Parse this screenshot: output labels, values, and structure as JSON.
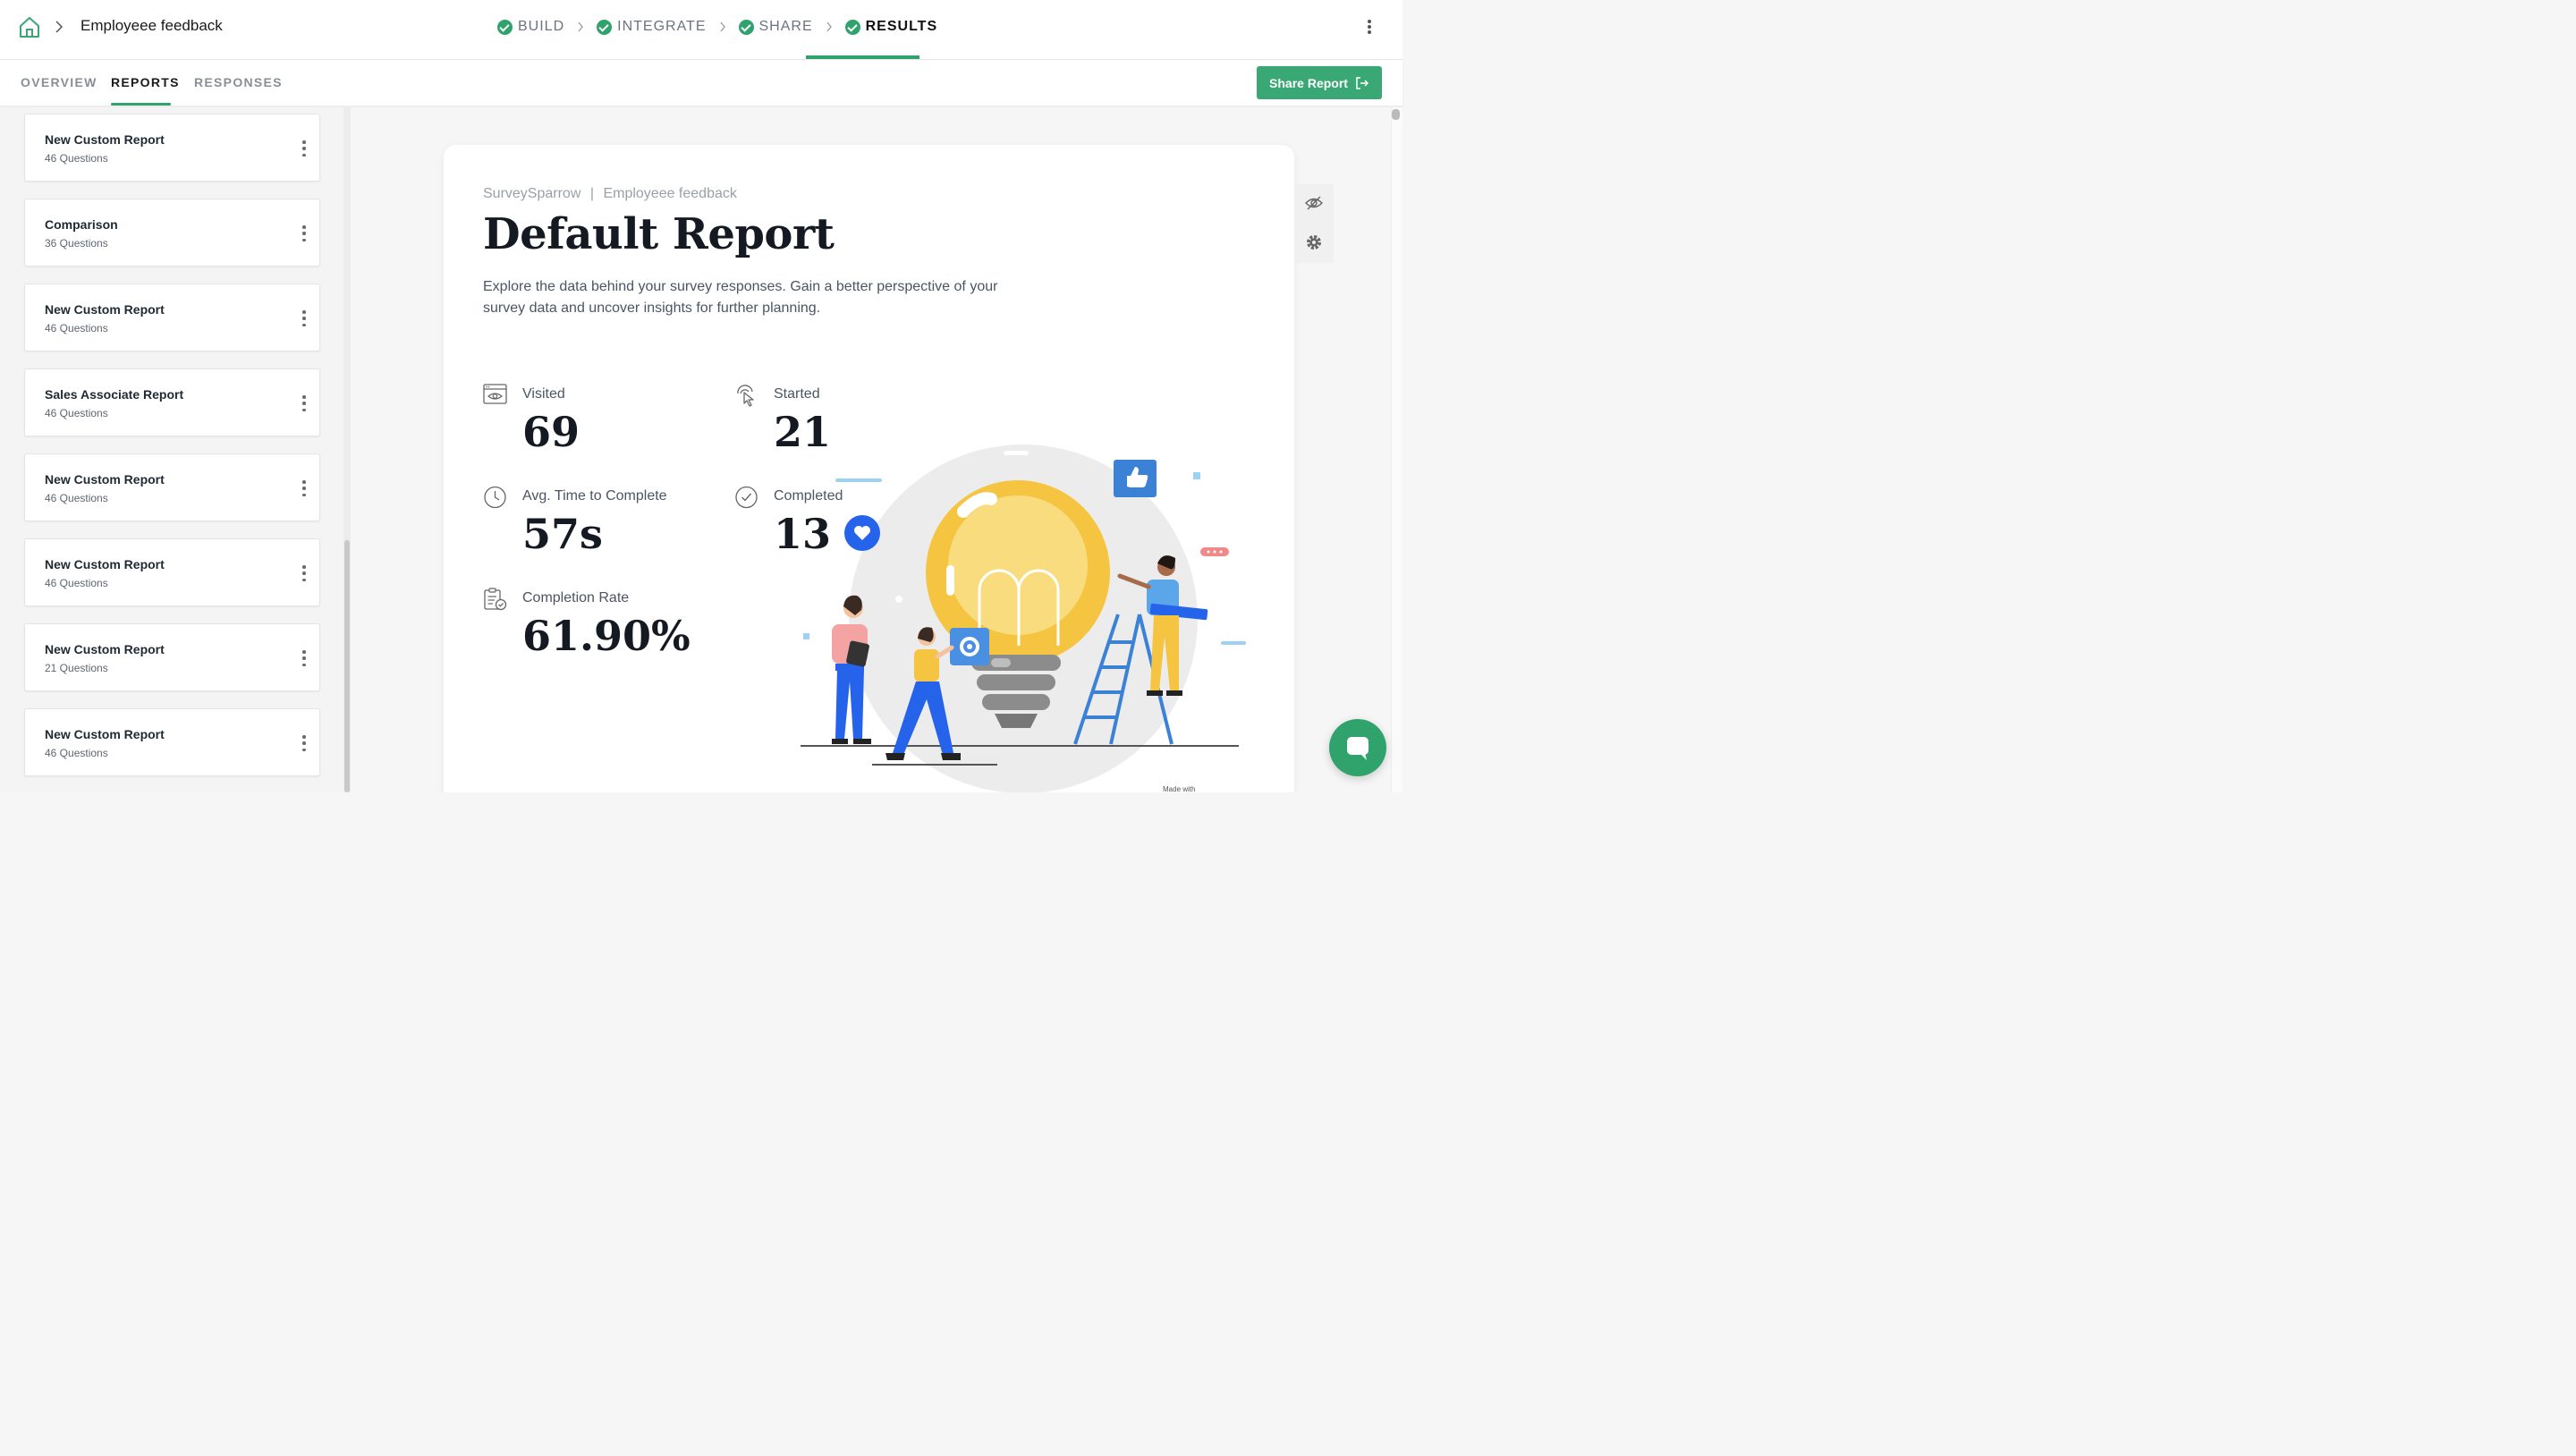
{
  "header": {
    "breadcrumb_title": "Employeee feedback",
    "steps": [
      {
        "label": "BUILD"
      },
      {
        "label": "INTEGRATE"
      },
      {
        "label": "SHARE"
      },
      {
        "label": "RESULTS"
      }
    ],
    "active_step": "RESULTS"
  },
  "subnav": {
    "tabs": [
      {
        "label": "OVERVIEW"
      },
      {
        "label": "REPORTS"
      },
      {
        "label": "RESPONSES"
      }
    ],
    "active_tab": "REPORTS",
    "share_label": "Share Report"
  },
  "sidebar": {
    "reports": [
      {
        "title": "New Custom Report",
        "subtitle": "46 Questions"
      },
      {
        "title": "Comparison",
        "subtitle": "36 Questions"
      },
      {
        "title": "New Custom Report",
        "subtitle": "46 Questions"
      },
      {
        "title": "Sales Associate Report",
        "subtitle": "46 Questions"
      },
      {
        "title": "New Custom Report",
        "subtitle": "46 Questions"
      },
      {
        "title": "New Custom Report",
        "subtitle": "46 Questions"
      },
      {
        "title": "New Custom Report",
        "subtitle": "21 Questions"
      },
      {
        "title": "New Custom Report",
        "subtitle": "46 Questions"
      }
    ]
  },
  "report": {
    "brand": "SurveySparrow",
    "separator": "|",
    "survey_name": "Employeee feedback",
    "title": "Default Report",
    "description": "Explore the data behind your survey responses. Gain a better perspective of your survey data and uncover insights for further planning.",
    "stats": {
      "visited": {
        "label": "Visited",
        "value": "69",
        "icon": "eye-browser-icon"
      },
      "started": {
        "label": "Started",
        "value": "21",
        "icon": "pointer-click-icon"
      },
      "avg_time": {
        "label": "Avg. Time to Complete",
        "value": "57s",
        "icon": "clock-icon"
      },
      "completed": {
        "label": "Completed",
        "value": "13",
        "icon": "check-circle-icon"
      },
      "completion_rate": {
        "label": "Completion Rate",
        "value": "61.90%",
        "icon": "clipboard-check-icon"
      }
    },
    "footer_text": "Made with"
  },
  "colors": {
    "accent": "#2fa36b",
    "bulb_yellow": "#f5c542",
    "illustration_blue": "#3b82d6"
  }
}
